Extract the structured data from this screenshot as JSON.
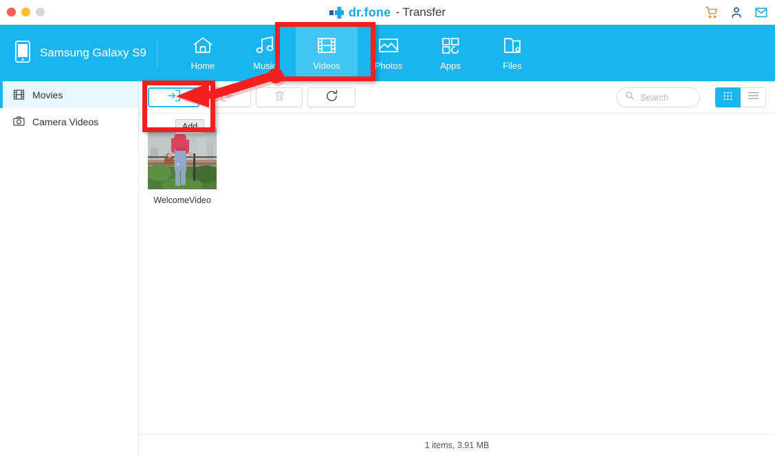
{
  "window": {
    "traffic_lights": [
      {
        "name": "close",
        "color": "#ff5f57"
      },
      {
        "name": "minimize",
        "color": "#ffbd2e"
      },
      {
        "name": "maximize",
        "color": "#d6d6d6"
      }
    ],
    "brand_name": "dr.fone",
    "brand_subtitle": "- Transfer",
    "title_icons": [
      {
        "name": "cart-icon",
        "color": "#f08a24"
      },
      {
        "name": "account-icon",
        "color": "#2a6496"
      },
      {
        "name": "mail-icon",
        "color": "#19a8e0"
      }
    ]
  },
  "device": {
    "icon": "phone-icon",
    "name": "Samsung Galaxy S9"
  },
  "nav": {
    "active": "Videos",
    "tabs": [
      {
        "label": "Home",
        "icon": "home-icon",
        "active": false
      },
      {
        "label": "Music",
        "icon": "music-icon",
        "active": false
      },
      {
        "label": "Videos",
        "icon": "video-film-icon",
        "active": true
      },
      {
        "label": "Photos",
        "icon": "photo-icon",
        "active": false
      },
      {
        "label": "Apps",
        "icon": "apps-grid-icon",
        "active": false
      },
      {
        "label": "Files",
        "icon": "folder-gear-icon",
        "active": false
      }
    ]
  },
  "sidebar": {
    "items": [
      {
        "label": "Movies",
        "icon": "film-icon",
        "active": true
      },
      {
        "label": "Camera Videos",
        "icon": "camera-icon",
        "active": false
      }
    ]
  },
  "toolbar": {
    "buttons": [
      {
        "name": "add-button",
        "icon": "import-arrow-icon",
        "label": "Add",
        "highlighted": true,
        "enabled": true
      },
      {
        "name": "export-button",
        "icon": "export-arrow-icon",
        "highlighted": false,
        "enabled": false
      },
      {
        "name": "delete-button",
        "icon": "trash-icon",
        "highlighted": false,
        "enabled": false
      },
      {
        "name": "refresh-button",
        "icon": "refresh-icon",
        "highlighted": false,
        "enabled": true
      }
    ],
    "tooltip": "Add",
    "search": {
      "placeholder": "Search",
      "value": ""
    },
    "view_modes": [
      {
        "name": "grid-view-button",
        "icon": "grid-dots-icon",
        "active": true
      },
      {
        "name": "list-view-button",
        "icon": "list-lines-icon",
        "active": false
      }
    ]
  },
  "content": {
    "items": [
      {
        "label": "WelcomeVideo",
        "type": "video-thumbnail"
      }
    ]
  },
  "status": {
    "text": "1 items, 3.91 MB"
  },
  "annotations": {
    "color": "#f41f1f",
    "boxes": [
      {
        "name": "videos-tab-highlight",
        "target": "Videos"
      },
      {
        "name": "add-button-highlight",
        "target": "Add"
      }
    ],
    "arrow": {
      "name": "pointer-arrow",
      "from": "Videos",
      "to": "Add"
    }
  },
  "colors": {
    "header_blue": "#19b5f0",
    "active_tab_blue": "#3fc6f3",
    "accent_blue": "#29b6f0",
    "sidebar_active_bg": "#e8f7fd",
    "annotation_red": "#f41f1f"
  }
}
